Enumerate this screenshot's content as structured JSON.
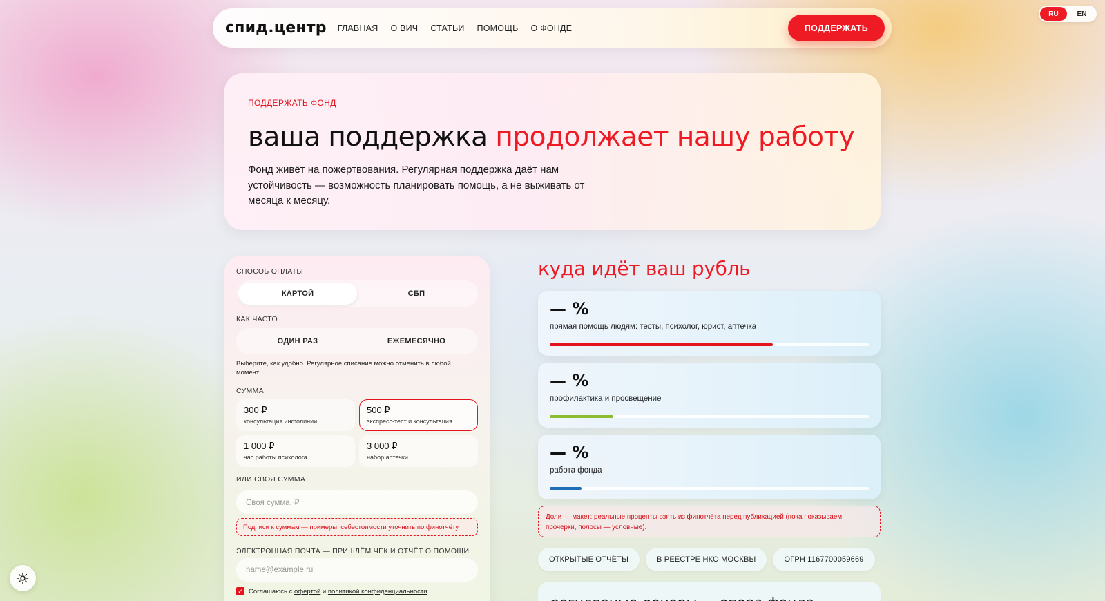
{
  "header": {
    "logo": "спид.центр",
    "nav": [
      "ГЛАВНАЯ",
      "О ВИЧ",
      "СТАТЬИ",
      "ПОМОЩЬ",
      "О ФОНДЕ"
    ],
    "cta": "ПОДДЕРЖАТЬ"
  },
  "lang": {
    "options": [
      "RU",
      "EN"
    ],
    "active": "RU"
  },
  "hero": {
    "eyebrow": "ПОДДЕРЖАТЬ ФОНД",
    "title_main": "ваша поддержка ",
    "title_accent": "продолжает нашу работу",
    "text": "Фонд живёт на пожертвования. Регулярная поддержка даёт нам устойчивость — возможность планировать помощь, а не выживать от месяца к месяцу."
  },
  "form": {
    "method_label": "СПОСОБ ОПЛАТЫ",
    "methods": [
      "КАРТОЙ",
      "СБП"
    ],
    "method_active": "КАРТОЙ",
    "freq_label": "КАК ЧАСТО",
    "freqs": [
      "ОДИН РАЗ",
      "ЕЖЕМЕСЯЧНО"
    ],
    "hint": "Выберите, как удобно. Регулярное списание можно отменить в любой момент.",
    "amount_label": "СУММА",
    "amounts": [
      {
        "value": "300 ₽",
        "desc": "консультация инфолинии"
      },
      {
        "value": "500 ₽",
        "desc": "экспресс-тест и консультация"
      },
      {
        "value": "1 000 ₽",
        "desc": "час работы психолога"
      },
      {
        "value": "3 000 ₽",
        "desc": "набор аптечки"
      }
    ],
    "amount_selected": "500 ₽",
    "custom_label": "ИЛИ СВОЯ СУММА",
    "custom_placeholder": "Своя сумма, ₽",
    "warning": "Подписи к суммам — примеры: себестоимости уточнить по финотчёту.",
    "email_label": "ЭЛЕКТРОННАЯ ПОЧТА — ПРИШЛЁМ ЧЕК И ОТЧЁТ О ПОМОЩИ",
    "email_placeholder": "name@example.ru",
    "agree_prefix": "Соглашаюсь с ",
    "agree_offer": "офертой",
    "agree_and": " и ",
    "agree_policy": "политикой конфиденциальности"
  },
  "where": {
    "title": "куда идёт ваш рубль",
    "items": [
      {
        "pct": "— %",
        "label": "прямая помощь людям: тесты, психолог, юрист, аптечка",
        "bar_fraction": 0.7,
        "color": "#e3141c"
      },
      {
        "pct": "— %",
        "label": "профилактика и просвещение",
        "bar_fraction": 0.2,
        "color": "#8cbd2e"
      },
      {
        "pct": "— %",
        "label": "работа фонда",
        "bar_fraction": 0.1,
        "color": "#1f6fb8"
      }
    ],
    "note": "Доли — макет: реальные проценты взять из финотчёта перед публикацией (пока показываем прочерки, полосы — условные).",
    "chips": [
      "ОТКРЫТЫЕ ОТЧЁТЫ",
      "В РЕЕСТРЕ НКО МОСКВЫ",
      "ОГРН 1167700059669"
    ],
    "bottom_title": "регулярные доноры — опора фонда"
  },
  "theme_toggle_icon": "sun-icon"
}
